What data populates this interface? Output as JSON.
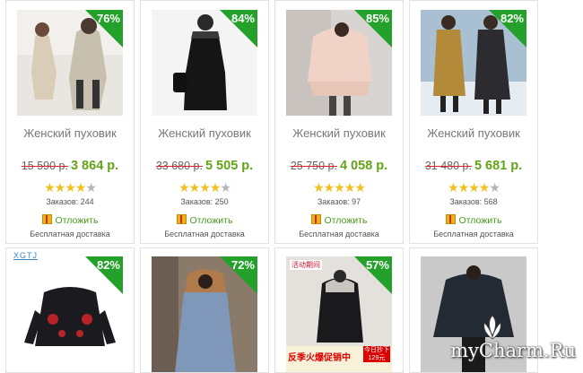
{
  "products": [
    {
      "discount": "76%",
      "title": "Женский пуховик",
      "old_price": "15 590 р.",
      "new_price": "3 864 р.",
      "rating": 4,
      "orders": "Заказов: 244",
      "postpone": "Отложить",
      "delivery": "Бесплатная доставка"
    },
    {
      "discount": "84%",
      "title": "Женский пуховик",
      "old_price": "33 680 р.",
      "new_price": "5 505 р.",
      "rating": 4,
      "orders": "Заказов: 250",
      "postpone": "Отложить",
      "delivery": "Бесплатная доставка"
    },
    {
      "discount": "85%",
      "title": "Женский пуховик",
      "old_price": "25 750 р.",
      "new_price": "4 058 р.",
      "rating": 5,
      "orders": "Заказов: 97",
      "postpone": "Отложить",
      "delivery": "Бесплатная доставка"
    },
    {
      "discount": "82%",
      "title": "Женский пуховик",
      "old_price": "31 480 р.",
      "new_price": "5 681 р.",
      "rating": 4,
      "orders": "Заказов: 568",
      "postpone": "Отложить",
      "delivery": "Бесплатная доставка"
    },
    {
      "discount": "82%",
      "brand_label": "XGTJ"
    },
    {
      "discount": "72%"
    },
    {
      "discount": "57%",
      "promo_text": "反季火爆促销中",
      "price_tag": "今日抄下 129元",
      "shop_text": "活动期间"
    },
    {
      "discount": ""
    }
  ],
  "watermark": "myCharm.Ru",
  "colors": {
    "badge": "#23a12a",
    "new_price": "#63a417",
    "star": "#f0c020",
    "link": "#4a9a1a"
  }
}
